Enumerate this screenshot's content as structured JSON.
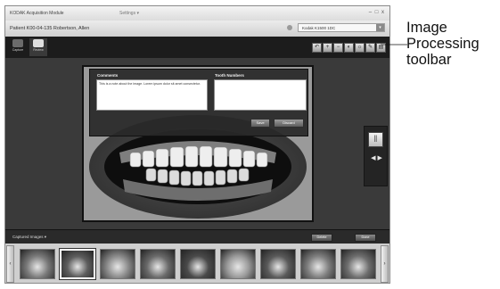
{
  "window": {
    "title": "KODAK Acquisition Module",
    "settings_menu": "Settings",
    "window_controls": "– □ x"
  },
  "patient": {
    "info": "Patient K00-04-135  Robertson, Allen",
    "device": "Kodak K1500 1DC"
  },
  "modes": [
    {
      "label": "Capture",
      "active": false
    },
    {
      "label": "Review",
      "active": true
    }
  ],
  "tools": [
    {
      "icon": "undo-icon",
      "glyph": "↶"
    },
    {
      "icon": "zoom-in-icon",
      "glyph": "+"
    },
    {
      "icon": "zoom-out-icon",
      "glyph": "−"
    },
    {
      "icon": "contrast-icon",
      "glyph": "◐"
    },
    {
      "icon": "brightness-icon",
      "glyph": "☼"
    },
    {
      "icon": "pen-icon",
      "glyph": "✎"
    },
    {
      "icon": "note-icon",
      "glyph": "▤"
    }
  ],
  "dialog": {
    "comments_title": "Comments",
    "comments_text": "This is a note about the image. Lorem ipsum dolor sit amet consectetur.",
    "tooth_numbers_title": "Tooth Numbers",
    "save_label": "Save",
    "discard_label": "Discard"
  },
  "captured": {
    "label": "Captured Images",
    "delete_label": "Delete",
    "done_label": "Done",
    "selected_index": 1,
    "thumbnail_count": 9
  },
  "callout": {
    "text": "Image Processing toolbar"
  },
  "colors": {
    "viewer_bg": "#3a3a3a",
    "toolbar_bg": "#1c1c1c",
    "strip_bg": "#cfcfcf"
  }
}
